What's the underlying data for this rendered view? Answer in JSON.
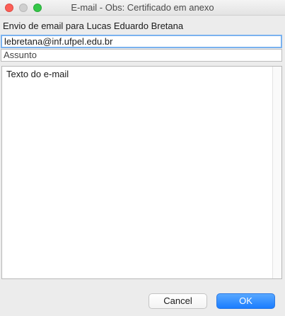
{
  "window": {
    "title": "E-mail - Obs: Certificado em anexo"
  },
  "form": {
    "heading": "Envio de email para Lucas Eduardo Bretana",
    "recipient_value": "lebretana@inf.ufpel.edu.br",
    "subject_placeholder": "Assunto",
    "body_placeholder": "Texto do e-mail"
  },
  "buttons": {
    "cancel_label": "Cancel",
    "ok_label": "OK"
  },
  "colors": {
    "close": "#fc5f57",
    "minimize": "#cfcfcf",
    "maximize": "#34c748",
    "focus_ring": "#7ab2ef",
    "primary_button": "#1a7cff"
  },
  "icons": {
    "close": "close-icon",
    "minimize": "minimize-icon",
    "maximize": "maximize-icon"
  }
}
